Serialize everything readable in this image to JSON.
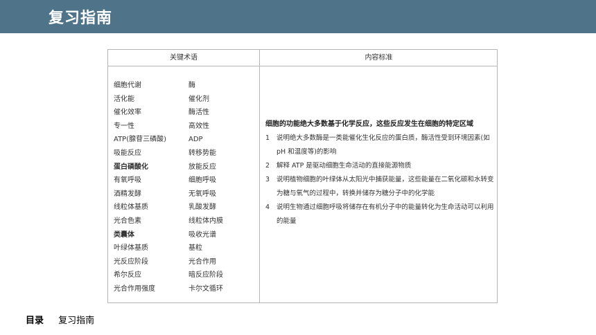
{
  "header": {
    "title": "复习指南"
  },
  "table": {
    "col_terms": "关键术语",
    "col_standards": "内容标准",
    "terms": [
      [
        "细胞代谢",
        "酶"
      ],
      [
        "活化能",
        "催化剂"
      ],
      [
        "催化效率",
        "酶活性"
      ],
      [
        "专一性",
        "高效性"
      ],
      [
        "ATP(腺苷三磷酸)",
        "ADP"
      ],
      [
        "吸能反应",
        "转移势能"
      ],
      [
        "蛋白磷酸化",
        "放能反应"
      ],
      [
        "有氧呼吸",
        "细胞呼吸"
      ],
      [
        "酒精发酵",
        "无氧呼吸"
      ],
      [
        "线粒体基质",
        "乳酸发酵"
      ],
      [
        "光合色素",
        "线粒体内膜"
      ],
      [
        "类囊体",
        "吸收光谱"
      ],
      [
        "叶绿体基质",
        "基粒"
      ],
      [
        "光反应阶段",
        "光合作用"
      ],
      [
        "希尔反应",
        "暗反应阶段"
      ],
      [
        "光合作用强度",
        "卡尔文循环"
      ]
    ],
    "topic": "细胞的功能绝大多数基于化学反应，这些反应发生在细胞的特定区域",
    "standards": [
      {
        "num": "1",
        "text": "说明绝大多数酶是一类能催化生化反应的蛋白质，酶活性受到环境因素(如 pH 和温度等)的影响"
      },
      {
        "num": "2",
        "text": "解释 ATP 是驱动细胞生命活动的直接能源物质"
      },
      {
        "num": "3",
        "text": "说明植物细胞的叶绿体从太阳光中捕获能量，这些能量在二氧化碳和水转变为糖与氧气的过程中，转换并储存为糖分子中的化学能"
      },
      {
        "num": "4",
        "text": "说明生物通过细胞呼吸将储存在有机分子中的能量转化为生命活动可以利用的能量"
      }
    ]
  },
  "footer": {
    "label": "目录",
    "title": "复习指南"
  }
}
